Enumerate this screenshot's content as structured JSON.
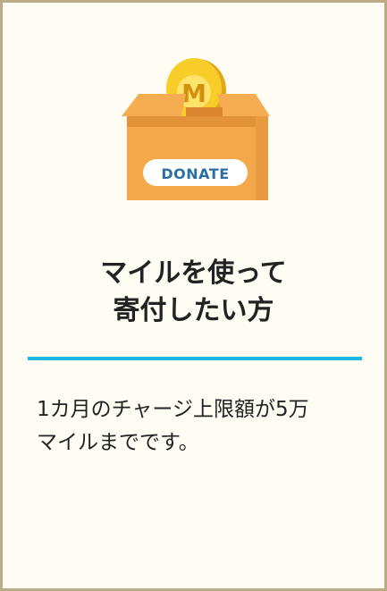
{
  "illustration": {
    "coin_letter": "M",
    "box_label": "DONATE"
  },
  "title": {
    "line1": "マイルを使って",
    "line2": "寄付したい方"
  },
  "description": {
    "line1": "1カ月のチャージ上限額が5万",
    "line2": "マイルまでです。"
  },
  "colors": {
    "accent": "#1fb7e6",
    "box": "#f6ad52",
    "coin": "#f8cd2a",
    "border": "#b9ab86"
  }
}
